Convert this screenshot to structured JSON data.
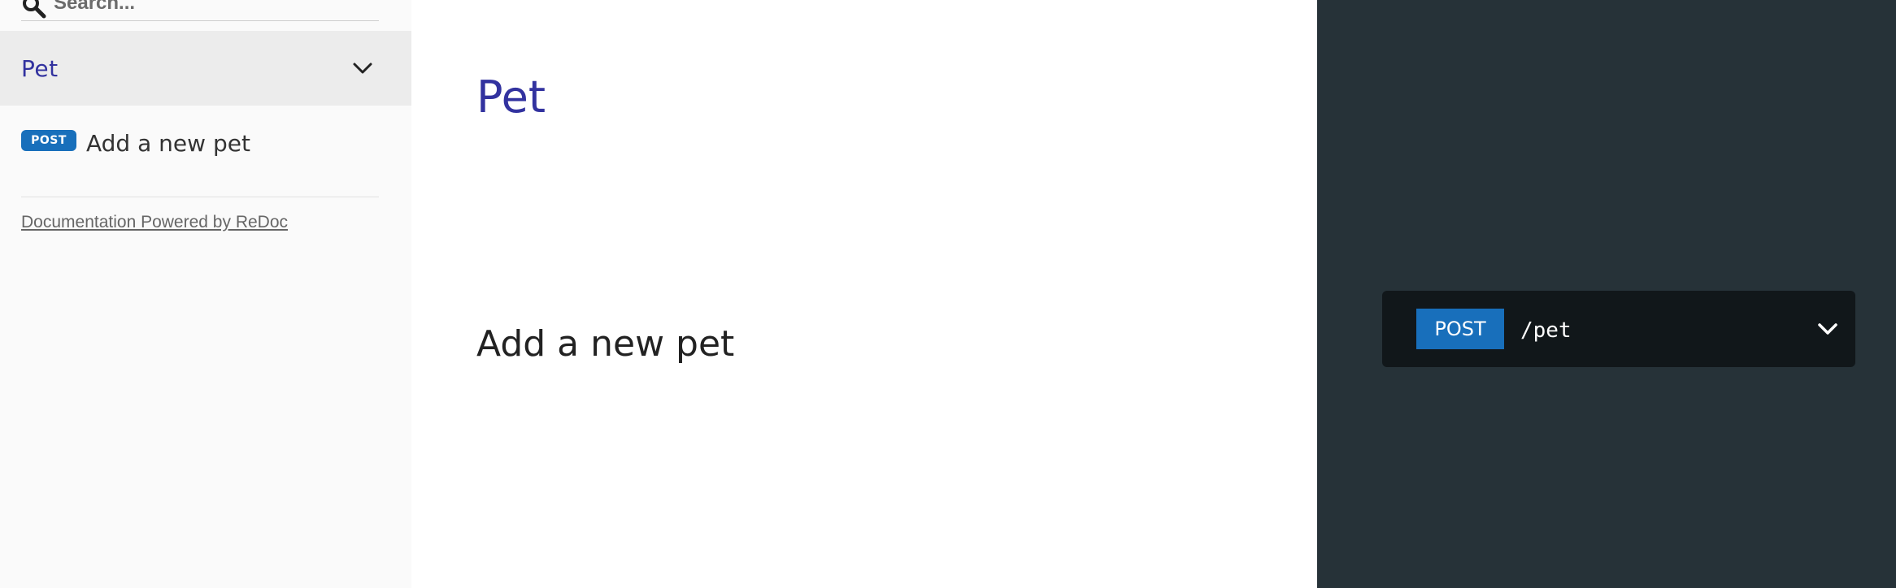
{
  "sidebar": {
    "search": {
      "placeholder": "Search..."
    },
    "groups": [
      {
        "label": "Pet",
        "expanded": true,
        "items": [
          {
            "method": "POST",
            "label": "Add a new pet"
          }
        ]
      }
    ],
    "footer_link": "Documentation Powered by ReDoc"
  },
  "content": {
    "section_title": "Pet",
    "operation_title": "Add a new pet"
  },
  "right_panel": {
    "endpoint": {
      "method": "POST",
      "path": "/pet"
    }
  },
  "colors": {
    "accent": "#32329f",
    "post_method": "#186fbb",
    "right_panel_bg": "#263238",
    "endpoint_bg": "#11171a",
    "sidebar_bg": "#fafafa",
    "sidebar_active_bg": "#ececec"
  },
  "icons": {
    "search": "search-icon",
    "group_toggle": "chevron-down-icon",
    "endpoint_toggle": "chevron-down-icon"
  }
}
